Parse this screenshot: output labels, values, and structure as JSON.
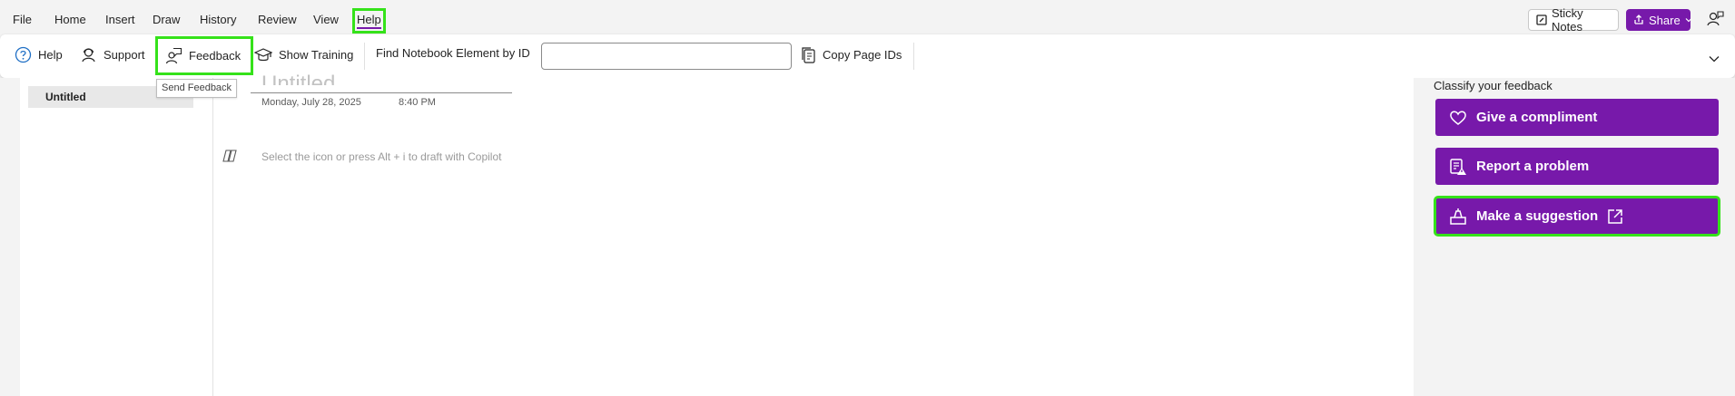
{
  "menu": {
    "items": [
      "File",
      "Home",
      "Insert",
      "Draw",
      "History",
      "Review",
      "View",
      "Help"
    ],
    "sticky_notes": "Sticky Notes",
    "share": "Share"
  },
  "ribbon": {
    "help": "Help",
    "support": "Support",
    "feedback": "Feedback",
    "show_training": "Show Training",
    "find_label": "Find Notebook Element by ID",
    "find_value": "",
    "copy_ids": "Copy Page IDs"
  },
  "tooltip": "Send Feedback",
  "pages": [
    {
      "title": "Untitled"
    }
  ],
  "note": {
    "title": "Untitled",
    "date": "Monday, July 28, 2025",
    "time": "8:40 PM",
    "copilot_hint": "Select the icon or press Alt + i to draft with Copilot"
  },
  "feedback_pane": {
    "heading": "Classify your feedback",
    "compliment": "Give a compliment",
    "problem": "Report a problem",
    "suggestion": "Make a suggestion"
  },
  "colors": {
    "accent": "#7719aa",
    "highlight": "#35e21a"
  }
}
